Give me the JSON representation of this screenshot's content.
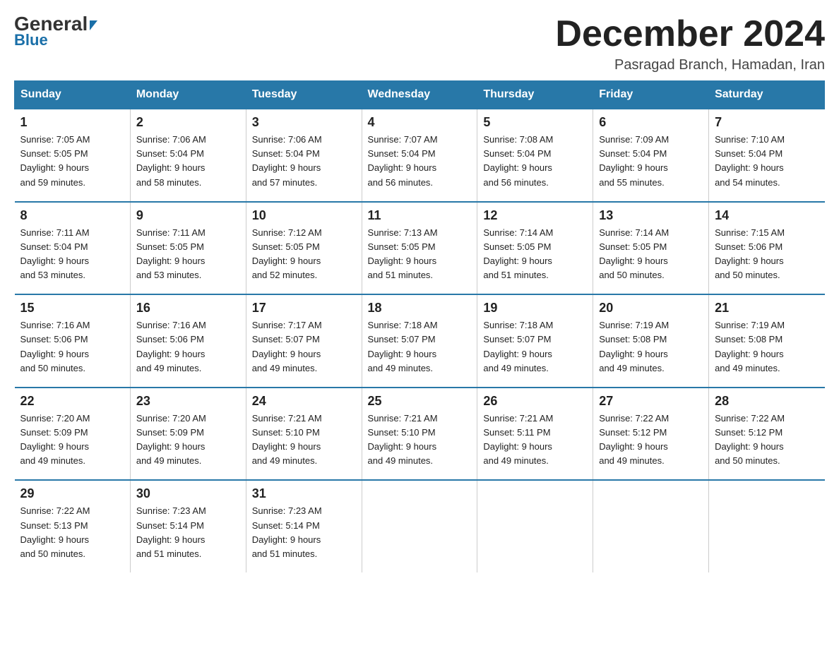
{
  "header": {
    "logo_general": "General",
    "logo_blue": "Blue",
    "month_title": "December 2024",
    "location": "Pasragad Branch, Hamadan, Iran"
  },
  "weekdays": [
    "Sunday",
    "Monday",
    "Tuesday",
    "Wednesday",
    "Thursday",
    "Friday",
    "Saturday"
  ],
  "weeks": [
    [
      {
        "day": "1",
        "sunrise": "7:05 AM",
        "sunset": "5:05 PM",
        "daylight": "9 hours and 59 minutes."
      },
      {
        "day": "2",
        "sunrise": "7:06 AM",
        "sunset": "5:04 PM",
        "daylight": "9 hours and 58 minutes."
      },
      {
        "day": "3",
        "sunrise": "7:06 AM",
        "sunset": "5:04 PM",
        "daylight": "9 hours and 57 minutes."
      },
      {
        "day": "4",
        "sunrise": "7:07 AM",
        "sunset": "5:04 PM",
        "daylight": "9 hours and 56 minutes."
      },
      {
        "day": "5",
        "sunrise": "7:08 AM",
        "sunset": "5:04 PM",
        "daylight": "9 hours and 56 minutes."
      },
      {
        "day": "6",
        "sunrise": "7:09 AM",
        "sunset": "5:04 PM",
        "daylight": "9 hours and 55 minutes."
      },
      {
        "day": "7",
        "sunrise": "7:10 AM",
        "sunset": "5:04 PM",
        "daylight": "9 hours and 54 minutes."
      }
    ],
    [
      {
        "day": "8",
        "sunrise": "7:11 AM",
        "sunset": "5:04 PM",
        "daylight": "9 hours and 53 minutes."
      },
      {
        "day": "9",
        "sunrise": "7:11 AM",
        "sunset": "5:05 PM",
        "daylight": "9 hours and 53 minutes."
      },
      {
        "day": "10",
        "sunrise": "7:12 AM",
        "sunset": "5:05 PM",
        "daylight": "9 hours and 52 minutes."
      },
      {
        "day": "11",
        "sunrise": "7:13 AM",
        "sunset": "5:05 PM",
        "daylight": "9 hours and 51 minutes."
      },
      {
        "day": "12",
        "sunrise": "7:14 AM",
        "sunset": "5:05 PM",
        "daylight": "9 hours and 51 minutes."
      },
      {
        "day": "13",
        "sunrise": "7:14 AM",
        "sunset": "5:05 PM",
        "daylight": "9 hours and 50 minutes."
      },
      {
        "day": "14",
        "sunrise": "7:15 AM",
        "sunset": "5:06 PM",
        "daylight": "9 hours and 50 minutes."
      }
    ],
    [
      {
        "day": "15",
        "sunrise": "7:16 AM",
        "sunset": "5:06 PM",
        "daylight": "9 hours and 50 minutes."
      },
      {
        "day": "16",
        "sunrise": "7:16 AM",
        "sunset": "5:06 PM",
        "daylight": "9 hours and 49 minutes."
      },
      {
        "day": "17",
        "sunrise": "7:17 AM",
        "sunset": "5:07 PM",
        "daylight": "9 hours and 49 minutes."
      },
      {
        "day": "18",
        "sunrise": "7:18 AM",
        "sunset": "5:07 PM",
        "daylight": "9 hours and 49 minutes."
      },
      {
        "day": "19",
        "sunrise": "7:18 AM",
        "sunset": "5:07 PM",
        "daylight": "9 hours and 49 minutes."
      },
      {
        "day": "20",
        "sunrise": "7:19 AM",
        "sunset": "5:08 PM",
        "daylight": "9 hours and 49 minutes."
      },
      {
        "day": "21",
        "sunrise": "7:19 AM",
        "sunset": "5:08 PM",
        "daylight": "9 hours and 49 minutes."
      }
    ],
    [
      {
        "day": "22",
        "sunrise": "7:20 AM",
        "sunset": "5:09 PM",
        "daylight": "9 hours and 49 minutes."
      },
      {
        "day": "23",
        "sunrise": "7:20 AM",
        "sunset": "5:09 PM",
        "daylight": "9 hours and 49 minutes."
      },
      {
        "day": "24",
        "sunrise": "7:21 AM",
        "sunset": "5:10 PM",
        "daylight": "9 hours and 49 minutes."
      },
      {
        "day": "25",
        "sunrise": "7:21 AM",
        "sunset": "5:10 PM",
        "daylight": "9 hours and 49 minutes."
      },
      {
        "day": "26",
        "sunrise": "7:21 AM",
        "sunset": "5:11 PM",
        "daylight": "9 hours and 49 minutes."
      },
      {
        "day": "27",
        "sunrise": "7:22 AM",
        "sunset": "5:12 PM",
        "daylight": "9 hours and 49 minutes."
      },
      {
        "day": "28",
        "sunrise": "7:22 AM",
        "sunset": "5:12 PM",
        "daylight": "9 hours and 50 minutes."
      }
    ],
    [
      {
        "day": "29",
        "sunrise": "7:22 AM",
        "sunset": "5:13 PM",
        "daylight": "9 hours and 50 minutes."
      },
      {
        "day": "30",
        "sunrise": "7:23 AM",
        "sunset": "5:14 PM",
        "daylight": "9 hours and 51 minutes."
      },
      {
        "day": "31",
        "sunrise": "7:23 AM",
        "sunset": "5:14 PM",
        "daylight": "9 hours and 51 minutes."
      },
      null,
      null,
      null,
      null
    ]
  ]
}
